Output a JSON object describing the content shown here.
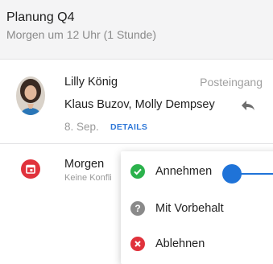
{
  "event_header": {
    "title": "Planung Q4",
    "subtitle": "Morgen um 12 Uhr (1 Stunde)"
  },
  "message": {
    "sender": "Lilly König",
    "folder": "Posteingang",
    "recipients": "Klaus Buzov, Molly Dempsey",
    "date": "8. Sep.",
    "details_link": "DETAILS",
    "reply_icon": "reply-icon"
  },
  "calendar_item": {
    "title": "Morgen",
    "subtitle": "Keine Konfli",
    "icon": "calendar-icon",
    "icon_color": "#e0323c"
  },
  "rsvp_menu": {
    "items": [
      {
        "label": "Annehmen",
        "icon": "check-circle-icon",
        "color": "#2bb24c"
      },
      {
        "label": "Mit Vorbehalt",
        "icon": "question-circle-icon",
        "color": "#8a8a8a"
      },
      {
        "label": "Ablehnen",
        "icon": "x-circle-icon",
        "color": "#e0323c"
      }
    ]
  },
  "colors": {
    "accent": "#1f73d8",
    "link": "#2f78d8"
  }
}
